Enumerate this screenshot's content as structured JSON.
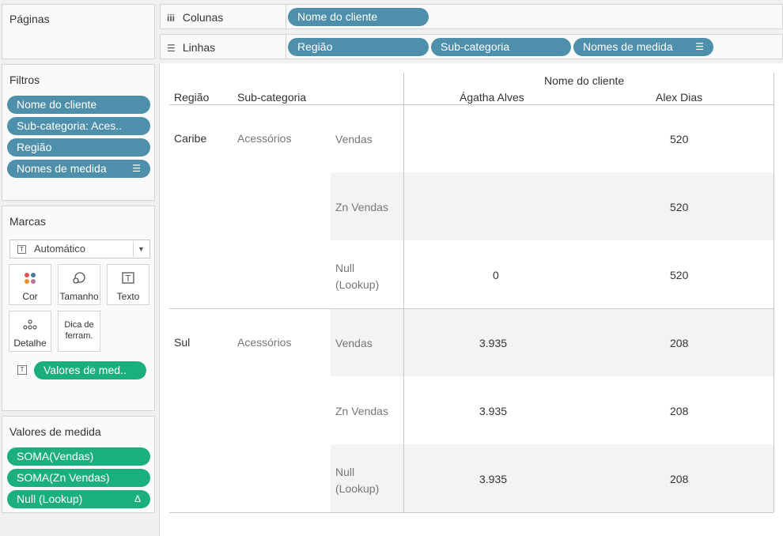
{
  "pages": {
    "title": "Páginas"
  },
  "columns_shelf": {
    "label": "Colunas",
    "pills": [
      "Nome do cliente"
    ]
  },
  "rows_shelf": {
    "label": "Linhas",
    "pills": [
      "Região",
      "Sub-categoria",
      "Nomes de medida"
    ]
  },
  "filters": {
    "title": "Filtros",
    "items": [
      "Nome do cliente",
      "Sub-categoria: Aces..",
      "Região",
      "Nomes de medida"
    ]
  },
  "marks": {
    "title": "Marcas",
    "type_dropdown": "Automático",
    "buttons": {
      "color": "Cor",
      "size": "Tamanho",
      "text": "Texto",
      "detail": "Detalhe",
      "tooltip": "Dica de ferram."
    },
    "text_pill": "Valores de med.."
  },
  "measure_values": {
    "title": "Valores de medida",
    "items": [
      "SOMA(Vendas)",
      "SOMA(Zn Vendas)",
      "Null (Lookup)"
    ]
  },
  "table": {
    "col_header_title": "Nome do cliente",
    "row_header_1": "Região",
    "row_header_2": "Sub-categoria",
    "customers": [
      "Ágatha Alves",
      "Alex Dias"
    ],
    "regions": [
      {
        "name": "Caribe",
        "subcategory": "Acessórios",
        "measures": [
          {
            "name": "Vendas",
            "values": [
              "",
              "520"
            ]
          },
          {
            "name": "Zn Vendas",
            "values": [
              "",
              "520"
            ]
          },
          {
            "name": "Null (Lookup)",
            "values": [
              "0",
              "520"
            ]
          }
        ]
      },
      {
        "name": "Sul",
        "subcategory": "Acessórios",
        "measures": [
          {
            "name": "Vendas",
            "values": [
              "3.935",
              "208"
            ]
          },
          {
            "name": "Zn Vendas",
            "values": [
              "3.935",
              "208"
            ]
          },
          {
            "name": "Null (Lookup)",
            "values": [
              "3.935",
              "208"
            ]
          }
        ]
      }
    ]
  },
  "colors": {
    "dimension_pill": "#4e8fab",
    "measure_pill": "#1bb07b",
    "band": "#f3f3f3"
  }
}
